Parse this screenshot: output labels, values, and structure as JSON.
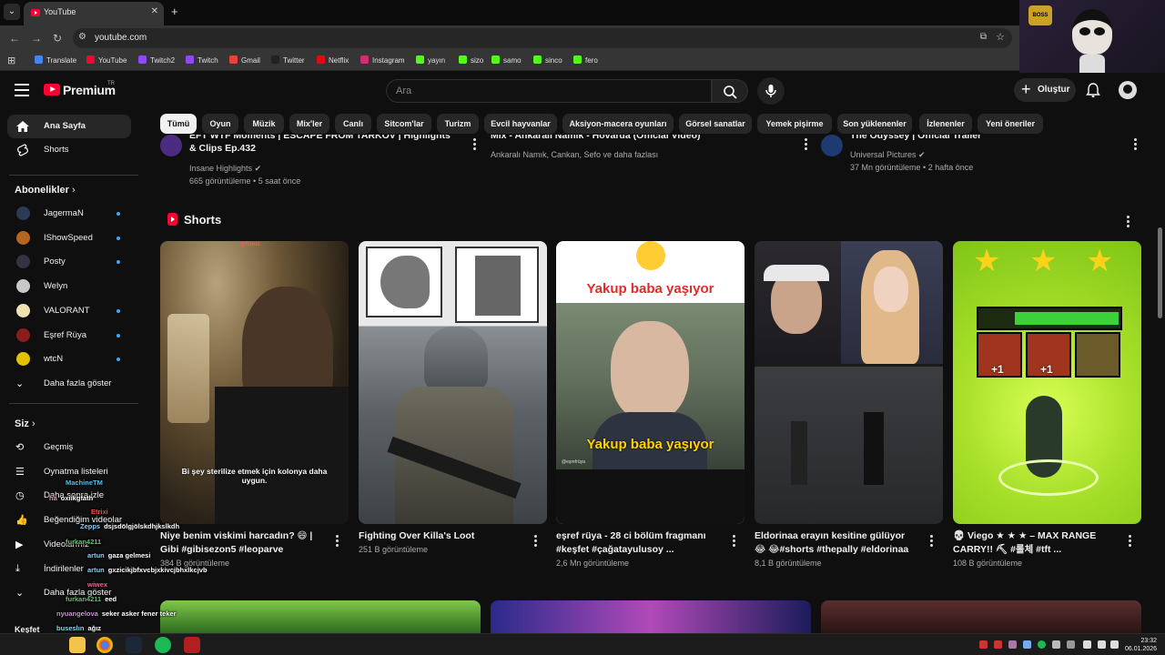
{
  "browser": {
    "tab_title": "YouTube",
    "url": "youtube.com",
    "bookmarks": [
      {
        "label": "Translate",
        "color": "#4285f4"
      },
      {
        "label": "YouTube",
        "color": "#ff0033"
      },
      {
        "label": "Twitch2",
        "color": "#9146ff"
      },
      {
        "label": "Twitch",
        "color": "#9146ff"
      },
      {
        "label": "Gmail",
        "color": "#ea4335"
      },
      {
        "label": "Twitter",
        "color": "#222222"
      },
      {
        "label": "Netflix",
        "color": "#e50914"
      },
      {
        "label": "Instagram",
        "color": "#d62976"
      },
      {
        "label": "yayın",
        "color": "#53fc18"
      },
      {
        "label": "sizo",
        "color": "#53fc18"
      },
      {
        "label": "samo",
        "color": "#53fc18"
      },
      {
        "label": "sinco",
        "color": "#53fc18"
      },
      {
        "label": "fero",
        "color": "#53fc18"
      }
    ]
  },
  "header": {
    "brand": "Premium",
    "region": "TR",
    "search_placeholder": "Ara",
    "create_label": "Oluştur"
  },
  "chips": [
    "Tümü",
    "Oyun",
    "Müzik",
    "Mix'ler",
    "Canlı",
    "Sitcom'lar",
    "Turizm",
    "Evcil hayvanlar",
    "Aksiyon-macera oyunları",
    "Görsel sanatlar",
    "Yemek pişirme",
    "Son yüklenenler",
    "İzlenenler",
    "Yeni öneriler"
  ],
  "sidebar": {
    "main": [
      {
        "label": "Ana Sayfa",
        "icon": "home-icon"
      },
      {
        "label": "Shorts",
        "icon": "shorts-icon"
      }
    ],
    "subs_heading": "Abonelikler",
    "subscriptions": [
      {
        "label": "JagermaN",
        "color": "#2b3a55"
      },
      {
        "label": "IShowSpeed",
        "color": "#b5651d"
      },
      {
        "label": "Posty",
        "color": "#334"
      },
      {
        "label": "Welyn",
        "color": "#c9c9c9"
      },
      {
        "label": "VALORANT",
        "color": "#f0e3b0"
      },
      {
        "label": "Eşref Rüya",
        "color": "#8a1c1c"
      },
      {
        "label": "wtcN",
        "color": "#e3c200"
      }
    ],
    "show_more": "Daha fazla göster",
    "you_heading": "Siz",
    "you_items": [
      "Geçmiş",
      "Oynatma listeleri",
      "Daha sonra izle",
      "Beğendiğim videolar",
      "Videolarınız",
      "İndirilenler",
      "Daha fazla göster"
    ],
    "explore_heading": "Keşfet"
  },
  "top_row": [
    {
      "title": "EFT WTF Moments | ESCAPE FROM TARKOV | Highlights & Clips Ep.432",
      "channel": "Insane Highlights",
      "meta": "665 görüntüleme • 5 saat önce",
      "verified": true
    },
    {
      "title": "Mix - Ankaralı Namık - Hovarda (Official Video)",
      "channel": "Ankaralı Namık, Cankan, Sefo ve daha fazlası",
      "meta": ""
    },
    {
      "title": "The Odyssey | Official Trailer",
      "channel": "Universal Pictures",
      "meta": "37 Mn görüntüleme • 2 hafta önce",
      "verified": true
    }
  ],
  "shorts_heading": "Shorts",
  "shorts": [
    {
      "title": "Niye benim viskimi harcadın? 😄 | Gibi  #gibisezon5 #leoparve",
      "views": "384 B görüntüleme",
      "caption": "Bi şey sterilize etmek için kolonya daha uygun.",
      "tag": "gibiviz"
    },
    {
      "title": "Fighting Over Killa's Loot",
      "views": "251 B görüntüleme"
    },
    {
      "title": "eşref rüya - 28 ci bölüm fragmanı #keşfet #çağatayulusoy ...",
      "views": "2,6 Mn görüntüleme",
      "caption": "Yakup baba yaşıyor",
      "sub": "@eşrefrüya"
    },
    {
      "title": "Eldorinaa erayın kesitine gülüyor😂 😂#shorts #thepally #eldorinaa ...",
      "views": "8,1 B görüntüleme"
    },
    {
      "title": "💀 Viego ★ ★ ★ – MAX RANGE CARRY!! ⛏ #롤체 #tft ...",
      "views": "108 B görüntüleme",
      "labels": [
        "+1",
        "+1"
      ]
    }
  ],
  "chat": [
    {
      "user": "MachineTM",
      "msg": "",
      "color": "#4fc3f7"
    },
    {
      "user": "ha",
      "msg": "oxiikgfath",
      "color": "#f48fb1"
    },
    {
      "user": "Etrixi",
      "msg": "",
      "color": "#ef5350"
    },
    {
      "user": "furkan4211",
      "msg": "",
      "color": "#66bb6a"
    },
    {
      "user": "Zepps",
      "msg": "dsjsdölgjölskdhjkslkdh",
      "color": "#90caf9"
    },
    {
      "user": "furkan4211",
      "msg": "",
      "color": "#66bb6a"
    },
    {
      "user": "artun",
      "msg": "gaza gelmesi",
      "color": "#81d4fa"
    },
    {
      "user": "artun",
      "msg": "gxzicikjbfxvcbjxkivcjbhxlkcjvb",
      "color": "#81d4fa"
    },
    {
      "user": "wiwex",
      "msg": "",
      "color": "#f06292"
    },
    {
      "user": "furkan4211",
      "msg": "eed",
      "color": "#66bb6a"
    },
    {
      "user": "nyuangelova",
      "msg": "seker asker fener teker",
      "color": "#ce93d8"
    },
    {
      "user": "buseslın",
      "msg": "ağız",
      "color": "#80deea"
    },
    {
      "user": "lochenoiz",
      "msg": "xde",
      "color": "#4fc3f7"
    }
  ],
  "clock": {
    "time": "23:32",
    "date": "06.01.2026"
  }
}
